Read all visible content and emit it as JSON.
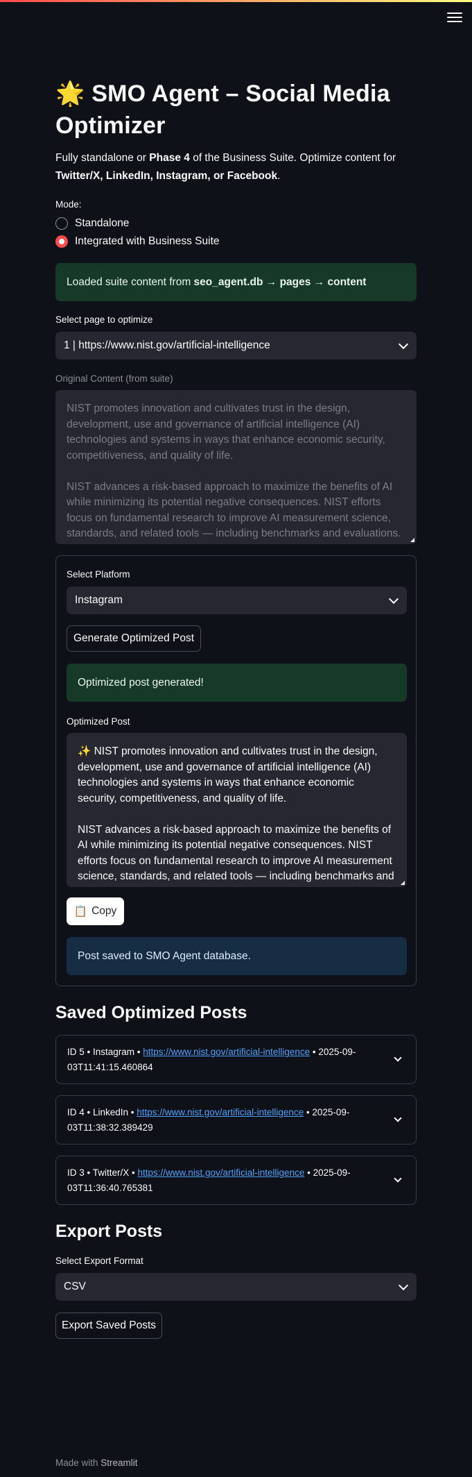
{
  "app": {
    "title_emoji": "🌟",
    "title": "SMO Agent – Social Media Optimizer",
    "lead_prefix": "Fully standalone or ",
    "lead_phase": "Phase 4",
    "lead_mid": " of the Business Suite. Optimize content for ",
    "lead_platforms": "Twitter/X, LinkedIn, Instagram, or Facebook",
    "lead_suffix": "."
  },
  "mode": {
    "label": "Mode:",
    "options": [
      "Standalone",
      "Integrated with Business Suite"
    ],
    "selected": "Integrated with Business Suite"
  },
  "suite_notice": {
    "prefix": "Loaded suite content from ",
    "source": "seo_agent.db → pages → content"
  },
  "page_select": {
    "label": "Select page to optimize",
    "value": "1 | https://www.nist.gov/artificial-intelligence"
  },
  "original_content": {
    "label": "Original Content (from suite)",
    "text": "NIST promotes innovation and cultivates trust in the design, development, use and governance of artificial intelligence (AI) technologies and systems in ways that enhance economic security, competitiveness, and quality of life.\n\nNIST advances a risk-based approach to maximize the benefits of AI while minimizing its potential negative consequences. NIST efforts focus on fundamental research to improve AI measurement science, standards, and related tools — including benchmarks and evaluations."
  },
  "platform": {
    "label": "Select Platform",
    "value": "Instagram",
    "generate_button": "Generate Optimized Post",
    "success": "Optimized post generated!",
    "optimized_label": "Optimized Post",
    "optimized_text": "✨ NIST promotes innovation and cultivates trust in the design, development, use and governance of artificial intelligence (AI) technologies and systems in ways that enhance economic security, competitiveness, and quality of life.\n\nNIST advances a risk-based approach to maximize the benefits of AI while minimizing its potential negative consequences. NIST efforts focus on fundamental research to improve AI measurement science, standards, and related tools — including benchmarks and evaluations.",
    "copy_icon": "📋",
    "copy_button": "Copy",
    "saved_info": "Post saved to SMO Agent database."
  },
  "saved_posts": {
    "heading": "Saved Optimized Posts",
    "items": [
      {
        "prefix": "ID 5 • Instagram • ",
        "url": "https://www.nist.gov/artificial-intelligence",
        "suffix": " • 2025-09-03T11:41:15.460864"
      },
      {
        "prefix": "ID 4 • LinkedIn • ",
        "url": "https://www.nist.gov/artificial-intelligence",
        "suffix": " • 2025-09-03T11:38:32.389429"
      },
      {
        "prefix": "ID 3 • Twitter/X • ",
        "url": "https://www.nist.gov/artificial-intelligence",
        "suffix": " • 2025-09-03T11:36:40.765381"
      }
    ]
  },
  "export": {
    "heading": "Export Posts",
    "format_label": "Select Export Format",
    "format_value": "CSV",
    "button": "Export Saved Posts"
  },
  "footer": {
    "prefix": "Made with ",
    "brand": "Streamlit"
  },
  "colors": {
    "background": "#0e1117",
    "accent": "#ff4b4b",
    "success_bg": "#173928",
    "info_bg": "#172d43",
    "link": "#4ea1ff"
  }
}
